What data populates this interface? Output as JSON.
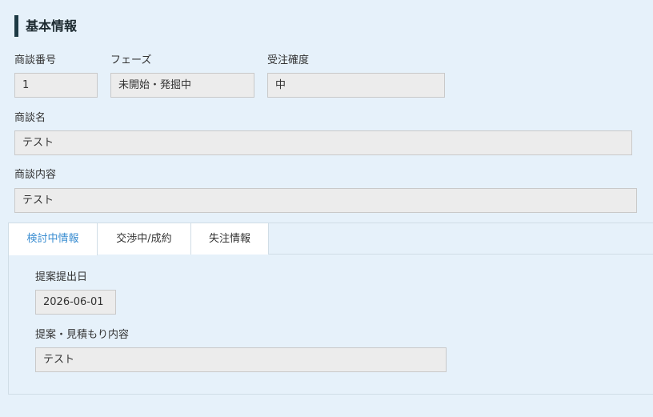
{
  "section": {
    "title": "基本情報"
  },
  "fields": {
    "deal_number": {
      "label": "商談番号",
      "value": "1"
    },
    "phase": {
      "label": "フェーズ",
      "value": "未開始・発掘中"
    },
    "order_certainty": {
      "label": "受注確度",
      "value": "中"
    },
    "deal_name": {
      "label": "商談名",
      "value": "テスト"
    },
    "deal_content": {
      "label": "商談内容",
      "value": "テスト"
    }
  },
  "tabs": [
    {
      "label": "検討中情報",
      "active": true
    },
    {
      "label": "交渉中/成約",
      "active": false
    },
    {
      "label": "失注情報",
      "active": false
    }
  ],
  "tab_content": {
    "proposal_date": {
      "label": "提案提出日",
      "value": "2026-06-01"
    },
    "proposal_estimate": {
      "label": "提案・見積もり内容",
      "value": "テスト"
    }
  },
  "colors": {
    "background": "#e6f1fa",
    "accent_bar": "#1d3a44",
    "active_tab_text": "#3a8dd1",
    "field_bg": "#ececec"
  }
}
